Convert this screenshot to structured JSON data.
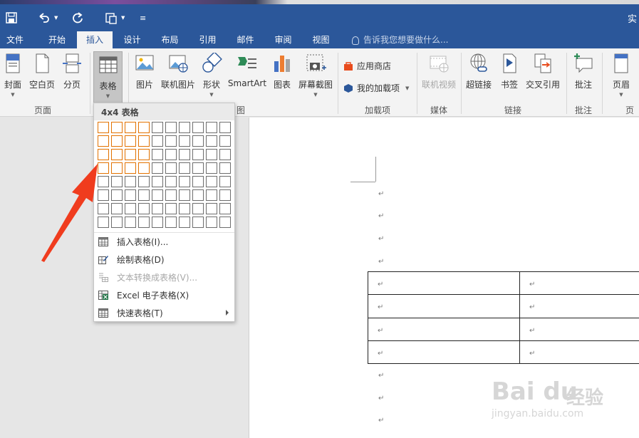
{
  "title_bar": {
    "title_partial": "实",
    "customize_label": "≡"
  },
  "tabs": [
    "文件",
    "开始",
    "插入",
    "设计",
    "布局",
    "引用",
    "邮件",
    "审阅",
    "视图"
  ],
  "tell_me": "告诉我您想要做什么...",
  "ribbon": {
    "pages_group": {
      "label": "页面",
      "cover": "封面",
      "blank_page": "空白页",
      "page_break": "分页"
    },
    "tables_group": {
      "table": "表格"
    },
    "illustrations_group": {
      "label_partial": "图",
      "picture": "图片",
      "online_picture": "联机图片",
      "shapes": "形状",
      "smartart": "SmartArt",
      "chart": "图表",
      "screenshot": "屏幕截图"
    },
    "addins_group": {
      "label": "加载项",
      "store": "应用商店",
      "my_addins": "我的加载项"
    },
    "media_group": {
      "label": "媒体",
      "online_video": "联机视频"
    },
    "links_group": {
      "label": "链接",
      "hyperlink": "超链接",
      "bookmark": "书签",
      "cross_reference": "交叉引用"
    },
    "comments_group": {
      "label": "批注",
      "comment": "批注"
    },
    "header_group": {
      "label_partial": "页",
      "header": "页眉"
    }
  },
  "table_dropdown": {
    "header": "4x4 表格",
    "grid": {
      "rows": 8,
      "cols": 10,
      "highlight_rows": 4,
      "highlight_cols": 4
    },
    "items": [
      {
        "label": "插入表格(I)...",
        "icon": "table-icon",
        "enabled": true,
        "submenu": false
      },
      {
        "label": "绘制表格(D)",
        "icon": "pencil-table-icon",
        "enabled": true,
        "submenu": false
      },
      {
        "label": "文本转换成表格(V)...",
        "icon": "text-to-table-icon",
        "enabled": false,
        "submenu": false
      },
      {
        "label": "Excel 电子表格(X)",
        "icon": "excel-icon",
        "enabled": true,
        "submenu": false
      },
      {
        "label": "快速表格(T)",
        "icon": "quick-table-icon",
        "enabled": true,
        "submenu": true
      }
    ]
  },
  "document": {
    "paragraph_mark": "↵",
    "table_rows": 4,
    "table_cols": 2
  },
  "watermark": {
    "brand": "Bai du",
    "text": "经验",
    "url": "jingyan.baidu.com"
  },
  "colors": {
    "ribbon_blue": "#2b579a",
    "grid_highlight": "#e27200",
    "arrow": "#f03c1e"
  }
}
